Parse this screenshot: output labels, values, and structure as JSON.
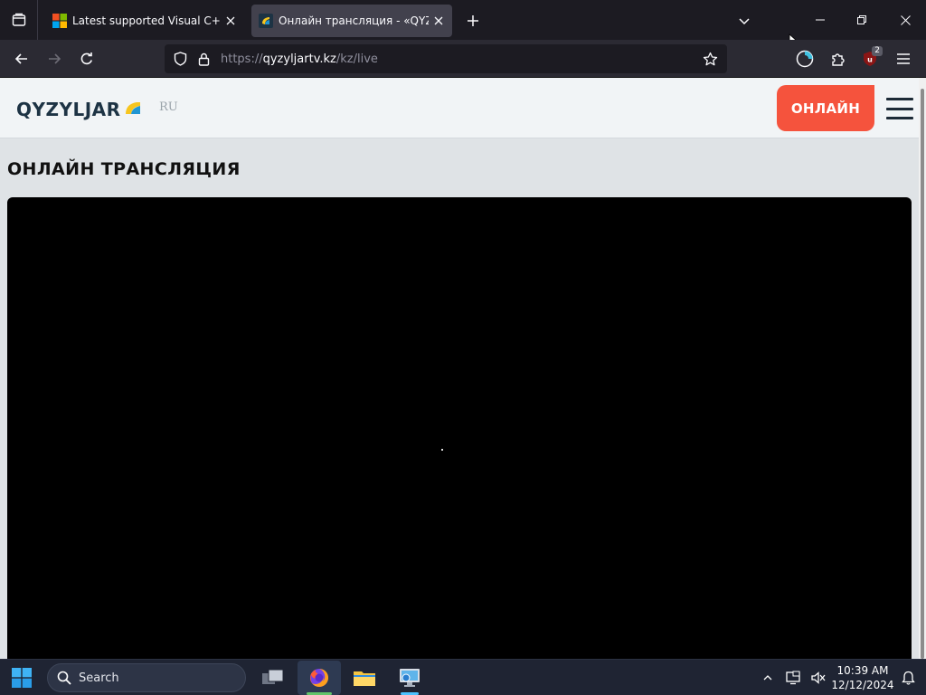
{
  "browser": {
    "tabs": [
      {
        "title": "Latest supported Visual C++ Redistributable",
        "active": false
      },
      {
        "title": "Онлайн трансляция - «QYZYLJAR»",
        "active": true
      }
    ],
    "url": {
      "prefix": "https://",
      "host": "qyzyljartv.kz",
      "path": "/kz/live"
    },
    "extension_badge": "2"
  },
  "site": {
    "logo": "QYZYLJAR",
    "lang_switch": "RU",
    "online_button": "ОНЛАЙН",
    "page_title": "ОНЛАЙН ТРАНСЛЯЦИЯ",
    "colors": {
      "accent": "#f5533d",
      "logo_text": "#1d3344",
      "logo_yellow": "#f7c51e",
      "logo_blue": "#2196d3"
    }
  },
  "taskbar": {
    "search_label": "Search",
    "time": "10:39 AM",
    "date": "12/12/2024",
    "apps": [
      "task-view",
      "firefox",
      "file-explorer",
      "remote-desktop"
    ]
  }
}
